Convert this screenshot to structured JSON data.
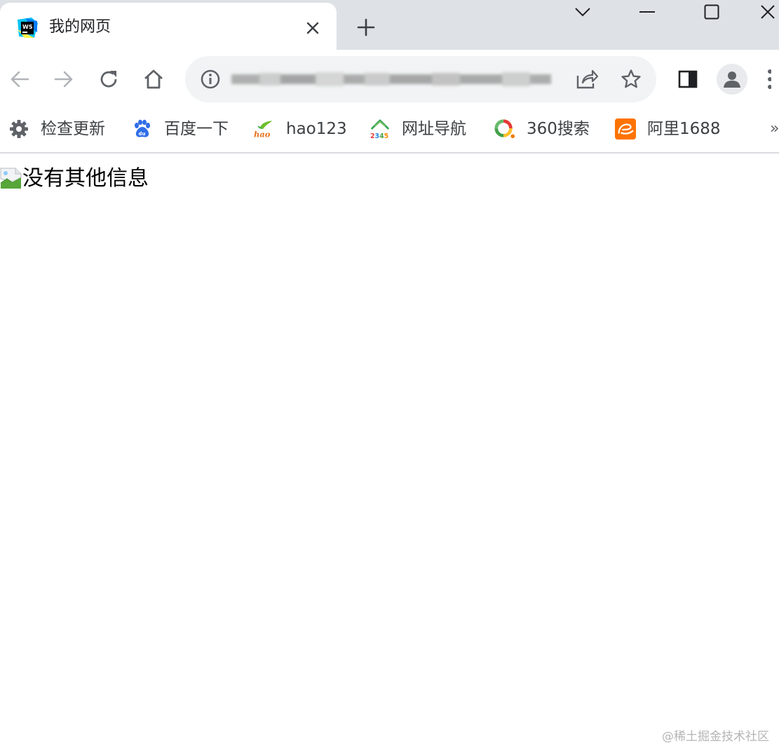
{
  "tab": {
    "title": "我的网页",
    "favicon": "webstorm-icon"
  },
  "toolbar": {
    "url": "",
    "icons": [
      "back-icon",
      "forward-icon",
      "reload-icon",
      "home-icon",
      "info-icon",
      "share-icon",
      "star-icon",
      "side-panel-icon",
      "profile-icon",
      "menu-icon"
    ]
  },
  "bookmarks": [
    {
      "label": "检查更新",
      "icon": "gear-icon"
    },
    {
      "label": "百度一下",
      "icon": "baidu-icon"
    },
    {
      "label": "hao123",
      "icon": "hao123-icon"
    },
    {
      "label": "网址导航",
      "icon": "2345-icon"
    },
    {
      "label": "360搜索",
      "icon": "360-search-icon"
    },
    {
      "label": "阿里1688",
      "icon": "alibaba-1688-icon"
    }
  ],
  "bookmarks_more": "»",
  "page": {
    "image_alt": "没有其他信息"
  },
  "watermark": "@稀土掘金技术社区",
  "colors": {
    "tabstrip": "#dee1e6",
    "omnibox": "#f1f3f4",
    "icon": "#5f6368"
  }
}
